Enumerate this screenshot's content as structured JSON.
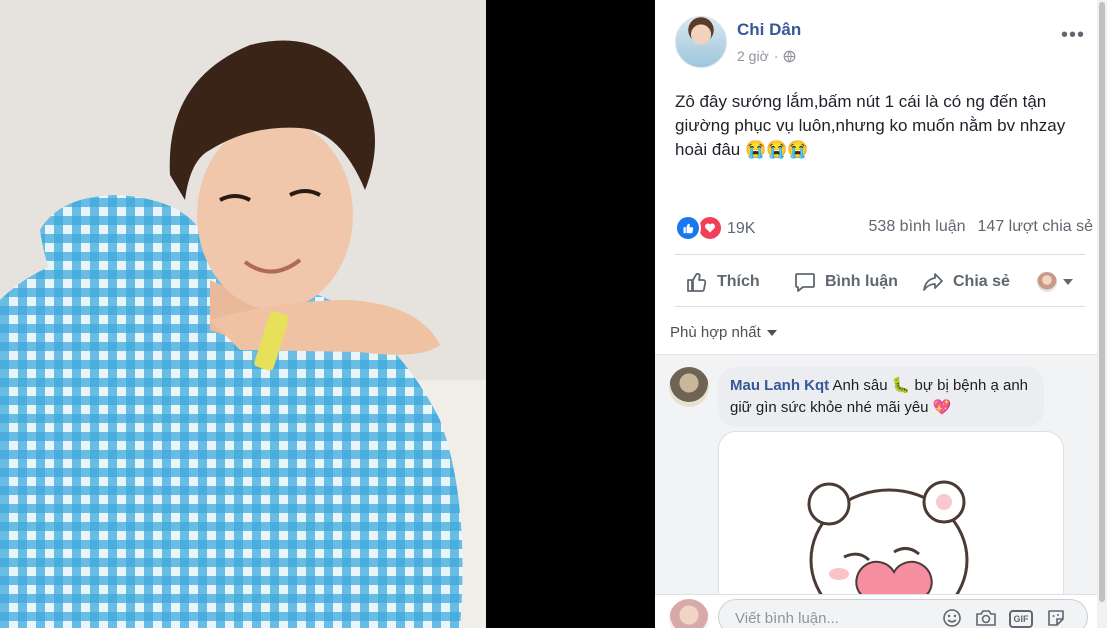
{
  "post": {
    "author": "Chi Dân",
    "time": "2 giờ",
    "separator": "·",
    "more": "•••",
    "text": "Zô đây sướng lắm,bấm nút 1 cái là có ng đến tận giường phục vụ luôn,nhưng ko muốn nằm bv nhzay hoài đâu 😭😭😭"
  },
  "reactions": {
    "count": "19K",
    "comments": "538 bình luận",
    "shares": "147 lượt chia sẻ"
  },
  "actions": {
    "like": "Thích",
    "comment": "Bình luận",
    "share": "Chia sẻ"
  },
  "sort": {
    "label": "Phù hợp nhất"
  },
  "comments": [
    {
      "name": "Mau Lanh Kqt",
      "text": "Anh sâu 🐛 bự bị bệnh ạ anh giữ gìn sức khỏe nhé mãi yêu 💖"
    }
  ],
  "composer": {
    "placeholder": "Viết bình luận..."
  },
  "icons": {
    "globe": "globe-icon",
    "like": "thumbs-up-icon",
    "comment": "speech-bubble-icon",
    "share": "share-arrow-icon",
    "emoji": "smiley-icon",
    "camera": "camera-icon",
    "gif": "gif-icon",
    "sticker": "sticker-icon"
  },
  "colors": {
    "link": "#385898",
    "like": "#1877f2",
    "love": "#f33e58",
    "muted": "#606770"
  }
}
